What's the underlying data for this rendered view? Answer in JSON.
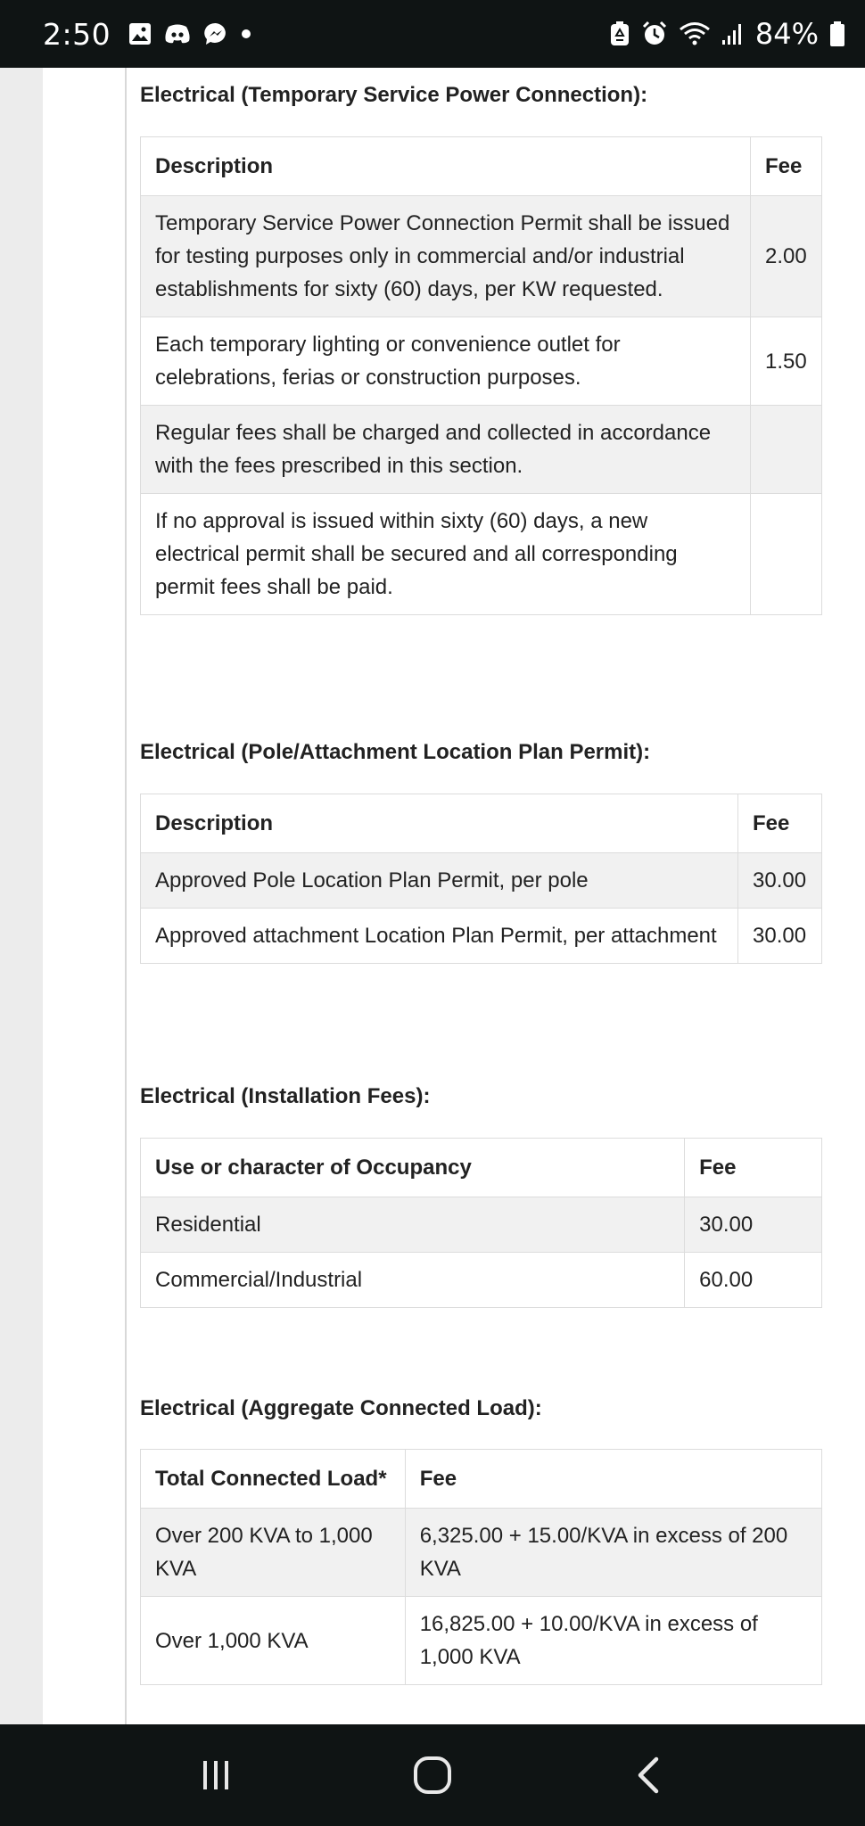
{
  "status_bar": {
    "time": "2:50",
    "battery_percent": "84%",
    "notification_icons": [
      "gallery-icon",
      "discord-icon",
      "messenger-icon",
      "dot-icon"
    ],
    "system_icons": [
      "battery-saver-icon",
      "alarm-icon",
      "wifi-icon",
      "signal-icon",
      "battery-icon"
    ]
  },
  "sections": [
    {
      "title": "Electrical (Temporary Service Power Connection):",
      "headers": [
        "Description",
        "Fee"
      ],
      "rows": [
        [
          "Temporary Service Power Connection Permit shall be issued for testing purposes only in commercial and/or industrial establishments for sixty (60) days, per KW requested.",
          "2.00"
        ],
        [
          "Each temporary lighting or convenience outlet for celebrations, ferias or construction purposes.",
          "1.50"
        ],
        [
          "Regular fees shall be charged and collected in accordance with the fees prescribed in this section.",
          ""
        ],
        [
          "If no approval is issued within sixty (60) days, a new electrical permit shall be secured and all corresponding permit fees shall be paid.",
          ""
        ]
      ]
    },
    {
      "title": "Electrical (Pole/Attachment Location Plan Permit):",
      "headers": [
        "Description",
        "Fee"
      ],
      "rows": [
        [
          "Approved Pole Location Plan Permit, per pole",
          "30.00"
        ],
        [
          "Approved attachment Location Plan Permit, per attachment",
          "30.00"
        ]
      ]
    },
    {
      "title": "Electrical (Installation Fees):",
      "headers": [
        "Use or character of Occupancy",
        "Fee"
      ],
      "rows": [
        [
          "Residential",
          "30.00"
        ],
        [
          "Commercial/Industrial",
          "60.00"
        ]
      ]
    },
    {
      "title": "Electrical (Aggregate Connected Load):",
      "headers": [
        "Total Connected Load*",
        "Fee"
      ],
      "rows": [
        [
          "Over 200 KVA to 1,000 KVA",
          "6,325.00 + 15.00/KVA in excess of 200 KVA"
        ],
        [
          "Over 1,000 KVA",
          "16,825.00 + 10.00/KVA in excess of 1,000 KVA"
        ]
      ]
    }
  ],
  "nav_bar": {
    "buttons": [
      "recent-apps-icon",
      "home-icon",
      "back-icon"
    ]
  }
}
